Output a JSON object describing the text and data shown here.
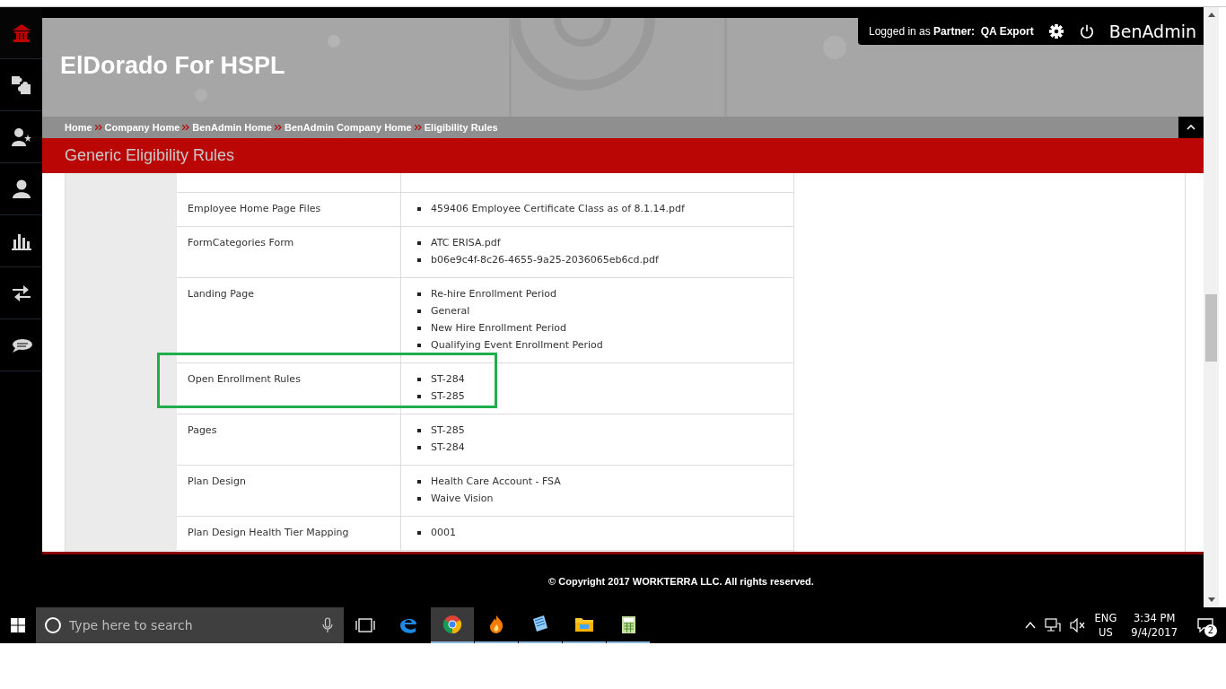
{
  "sidebar": {
    "items": [
      {
        "kind": "home",
        "selected": true
      },
      {
        "kind": "puzzle",
        "selected": false
      },
      {
        "kind": "person-star",
        "selected": false
      },
      {
        "kind": "person",
        "selected": false
      },
      {
        "kind": "chart",
        "selected": false
      },
      {
        "kind": "arrows",
        "selected": false
      },
      {
        "kind": "chat",
        "selected": false
      }
    ]
  },
  "header": {
    "site_title": "ElDorado For HSPL",
    "login": {
      "prefix": "Logged in as",
      "role": "Partner:",
      "user": "QA Export"
    },
    "app_name": "BenAdmin"
  },
  "breadcrumbs": [
    "Home",
    "Company Home",
    "BenAdmin Home",
    "BenAdmin Company Home",
    "Eligibility Rules"
  ],
  "page_title": "Generic Eligibility Rules",
  "rules": [
    {
      "name": "Employee Home Page Files",
      "values": [
        "459406 Employee Certificate Class as of 8.1.14.pdf"
      ],
      "highlighted": false
    },
    {
      "name": "FormCategories Form",
      "values": [
        "ATC ERISA.pdf",
        "b06e9c4f-8c26-4655-9a25-2036065eb6cd.pdf"
      ],
      "highlighted": false
    },
    {
      "name": "Landing Page",
      "values": [
        "Re-hire Enrollment Period",
        "General",
        "New Hire Enrollment Period",
        "Qualifying Event Enrollment Period"
      ],
      "highlighted": false
    },
    {
      "name": "Open Enrollment Rules",
      "values": [
        "ST-284",
        "ST-285"
      ],
      "highlighted": true
    },
    {
      "name": "Pages",
      "values": [
        "ST-285",
        "ST-284"
      ],
      "highlighted": false
    },
    {
      "name": "Plan Design",
      "values": [
        "Health Care Account - FSA",
        "Waive Vision"
      ],
      "highlighted": false
    },
    {
      "name": "Plan Design Health Tier Mapping",
      "values": [
        "0001"
      ],
      "highlighted": false
    }
  ],
  "footer": {
    "copyright": "© Copyright 2017 WORKTERRA LLC. All rights reserved."
  },
  "taskbar": {
    "search_placeholder": "Type here to search",
    "apps": [
      {
        "kind": "edge",
        "running": false,
        "selected": false
      },
      {
        "kind": "chrome",
        "running": true,
        "selected": true
      },
      {
        "kind": "flame",
        "running": true,
        "selected": false
      },
      {
        "kind": "notepad",
        "running": true,
        "selected": false
      },
      {
        "kind": "folder",
        "running": true,
        "selected": false
      },
      {
        "kind": "calculator",
        "running": true,
        "selected": false
      }
    ],
    "language": "ENG",
    "region": "US",
    "time": "3:34 PM",
    "date": "9/4/2017",
    "notifications": "2"
  }
}
